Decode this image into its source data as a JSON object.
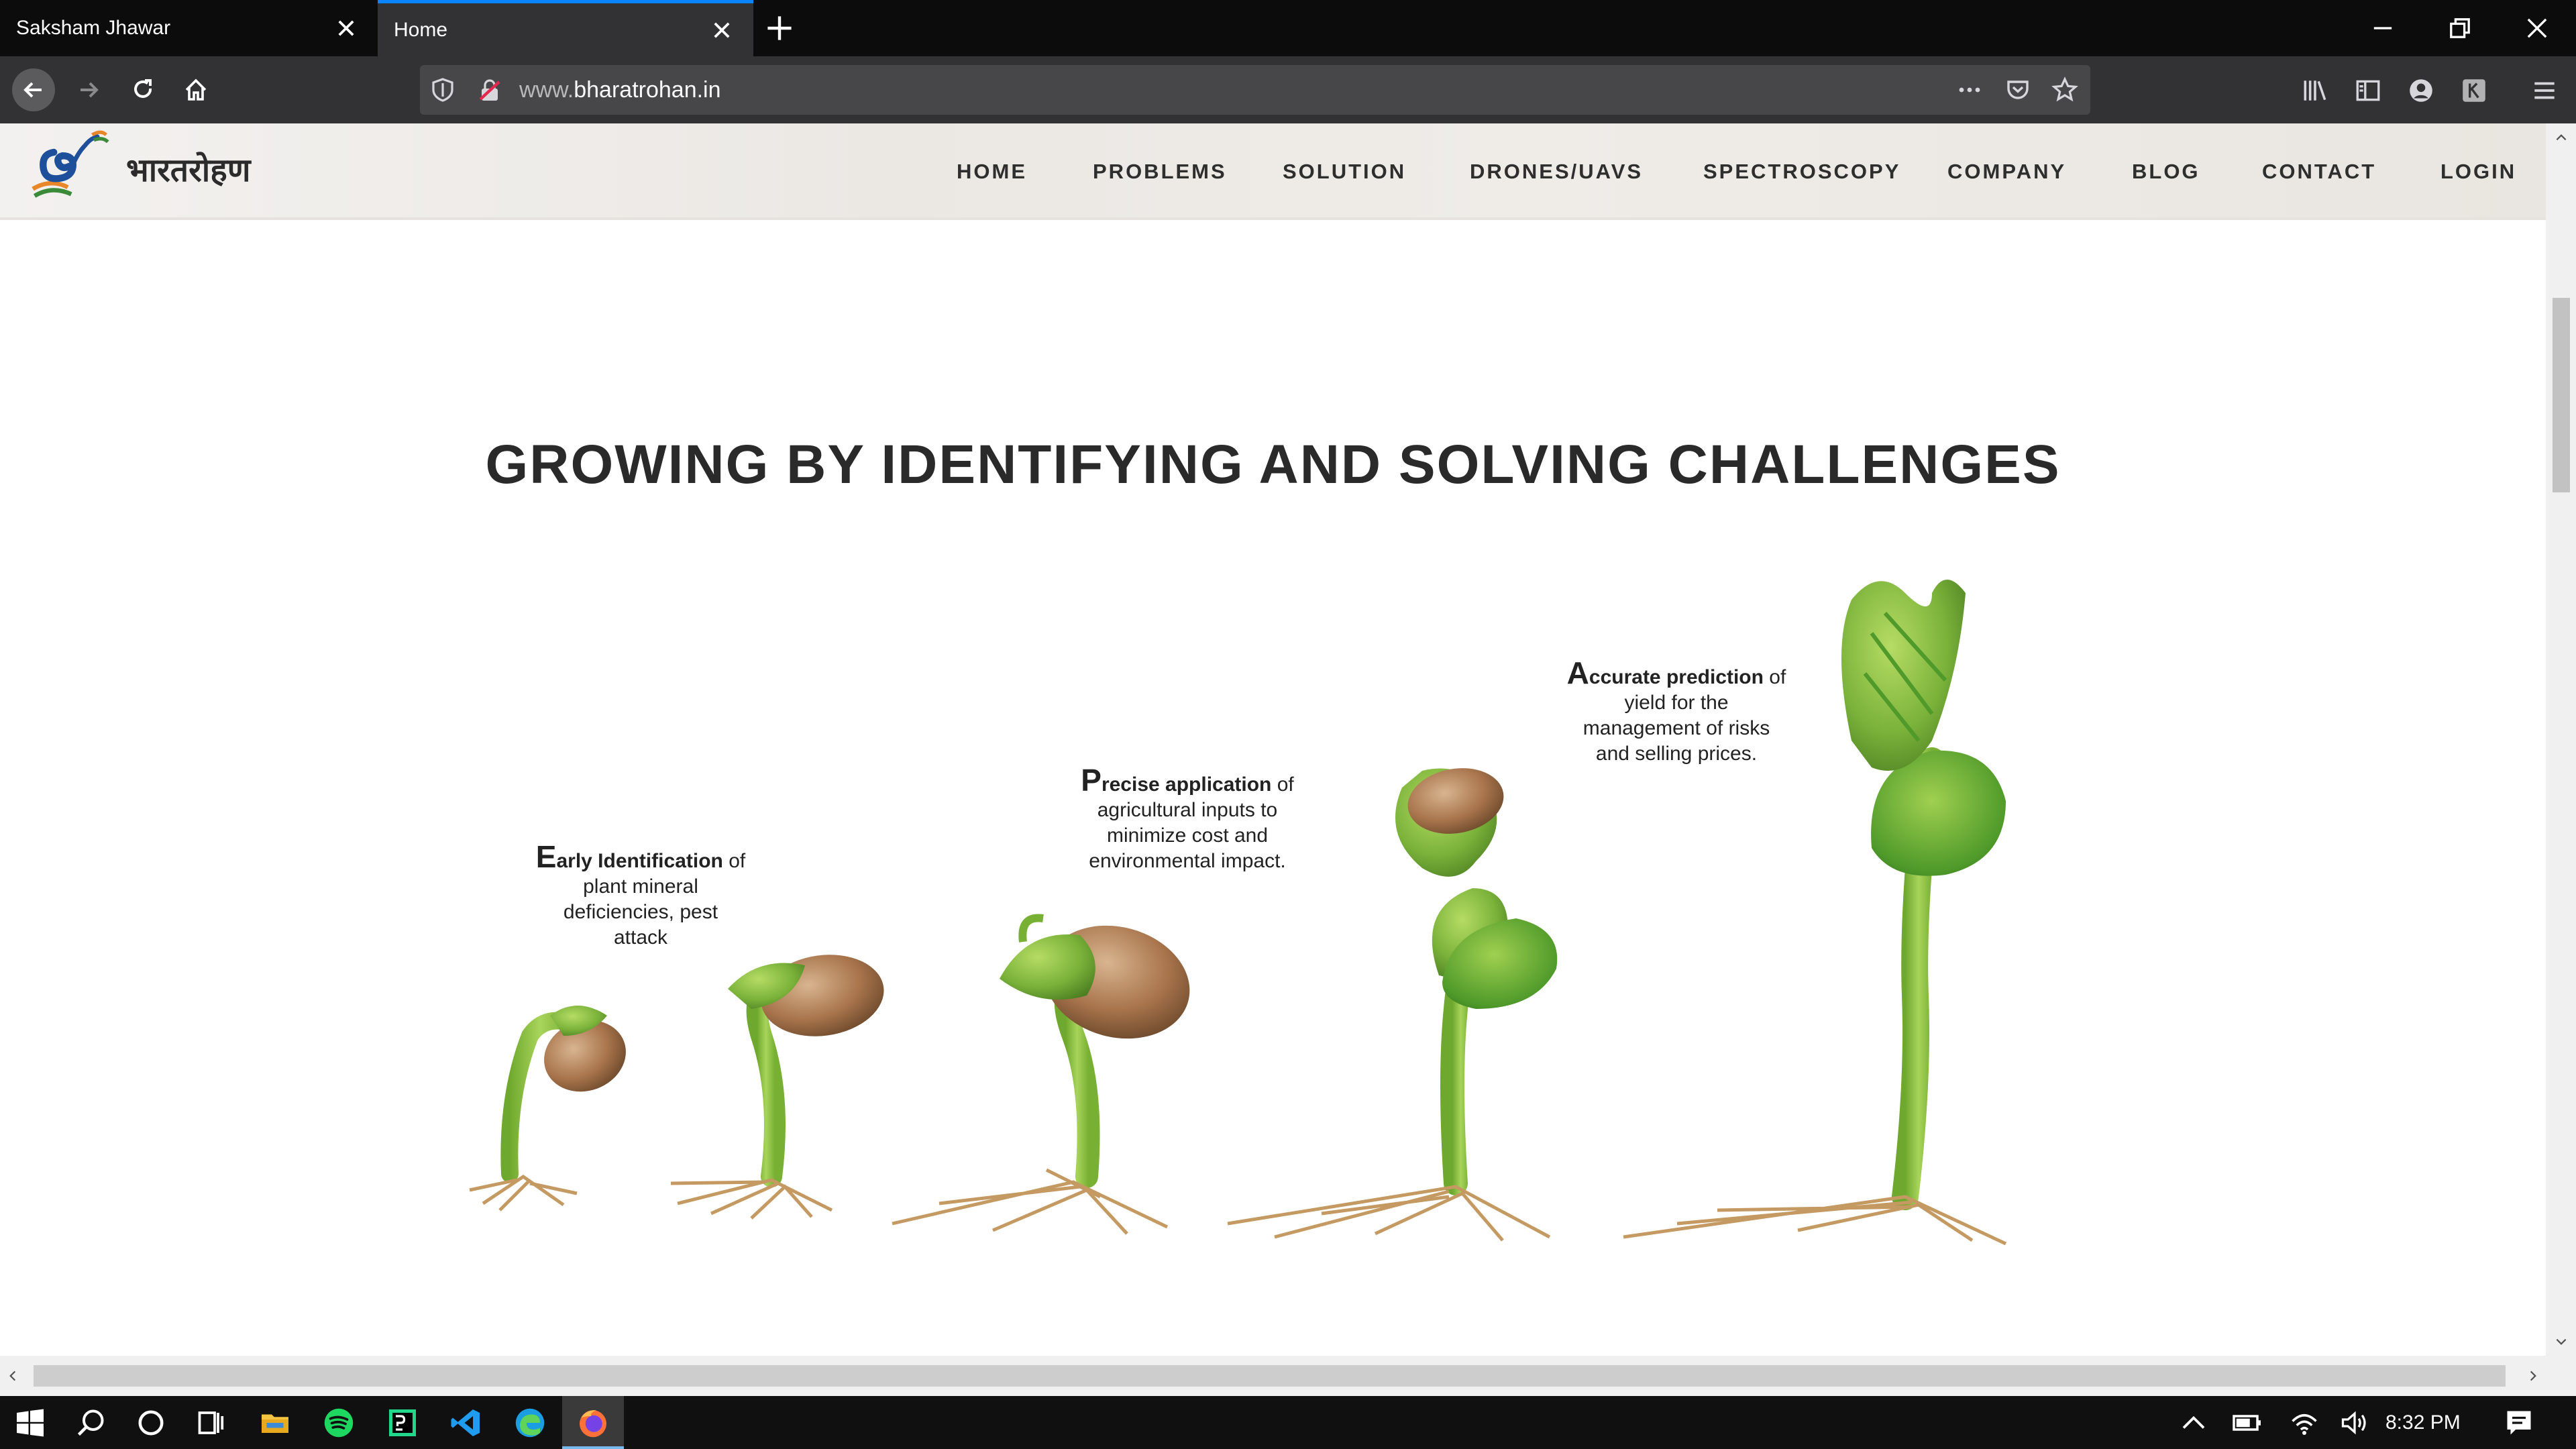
{
  "browser": {
    "tabs": [
      {
        "label": "Saksham Jhawar",
        "active": false
      },
      {
        "label": "Home",
        "active": true
      }
    ],
    "url_prefix": "www.",
    "url_domain": "bharatrohan.in"
  },
  "site": {
    "brand": "भारतरोहण",
    "menu": [
      "HOME",
      "PROBLEMS",
      "SOLUTION",
      "DRONES/UAVS",
      "SPECTROSCOPY",
      "COMPANY",
      "BLOG",
      "CONTACT",
      "LOGIN"
    ]
  },
  "main": {
    "headline": "GROWING BY IDENTIFYING AND SOLVING CHALLENGES",
    "captions": [
      {
        "first": "E",
        "bold_rest": "arly Identification",
        "tail": " of",
        "lines": [
          "plant mineral",
          "deficiencies, pest",
          "attack"
        ]
      },
      {
        "first": "P",
        "bold_rest": "recise application",
        "tail": " of",
        "lines": [
          "agricultural inputs to",
          "minimize cost and",
          "environmental impact."
        ]
      },
      {
        "first": "A",
        "bold_rest": "ccurate prediction",
        "tail": " of",
        "lines": [
          "yield for the",
          "management of risks",
          "and selling prices."
        ]
      }
    ]
  },
  "taskbar": {
    "time": "8:32 PM",
    "apps": [
      "windows-start",
      "search",
      "cortana",
      "task-view",
      "file-explorer",
      "spotify",
      "pycharm",
      "vscode",
      "edge",
      "firefox"
    ]
  },
  "colors": {
    "tab_accent": "#0a84ff",
    "plant_green": "#8cc63f",
    "seed_brown": "#9a6b45",
    "root_tan": "#c49a62"
  }
}
